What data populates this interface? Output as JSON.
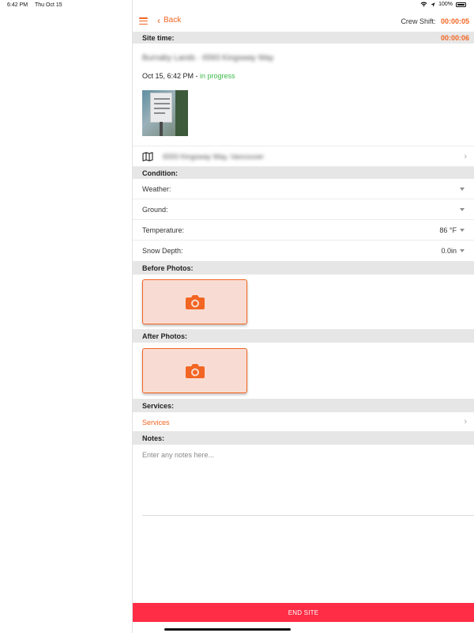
{
  "status_bar": {
    "time": "6:42 PM",
    "date": "Thu Oct 15",
    "battery": "100%",
    "icons": [
      "wifi-icon",
      "location-arrow-icon",
      "battery-icon"
    ]
  },
  "nav": {
    "back_label": "Back",
    "crew_shift_label": "Crew Shift:",
    "crew_shift_value": "00:00:05"
  },
  "site_time": {
    "label": "Site time:",
    "value": "00:00:06"
  },
  "site": {
    "address_blurred": "Burnaby Lands · 6593 Kingsway Way",
    "date": "Oct 15, 6:42 PM - ",
    "status": "in progress",
    "location_blurred": "6593 Kingsway Way, Vancouver"
  },
  "condition": {
    "header": "Condition:",
    "weather_label": "Weather:",
    "ground_label": "Ground:",
    "temperature_label": "Temperature:",
    "temperature_value": "86 °F",
    "snow_depth_label": "Snow Depth:",
    "snow_depth_value": "0.0in"
  },
  "before_photos": {
    "header": "Before Photos:"
  },
  "after_photos": {
    "header": "After Photos:"
  },
  "services": {
    "header": "Services:",
    "row_label": "Services"
  },
  "notes": {
    "header": "Notes:",
    "placeholder": "Enter any notes here..."
  },
  "footer": {
    "end_site_label": "END SITE"
  },
  "colors": {
    "accent": "#f26522",
    "status_green": "#3cb94a",
    "end_button": "#ff2d45",
    "section_bg": "#e6e6e6"
  }
}
